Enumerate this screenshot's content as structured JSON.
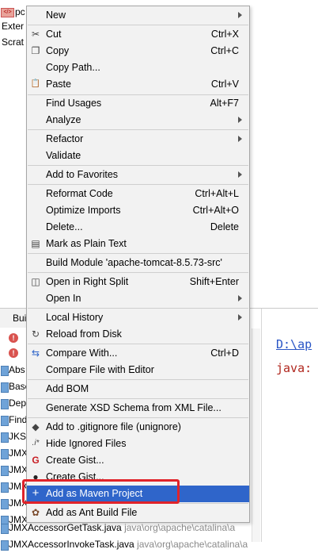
{
  "background": {
    "project": {
      "row1": "pc",
      "row2": "Exter",
      "row3": "Scrat"
    },
    "tool_tab": "Bui",
    "file_list": [
      {
        "name": "Abs",
        "path": ""
      },
      {
        "name": "Base",
        "path": ""
      },
      {
        "name": "Dep",
        "path": ""
      },
      {
        "name": "Find",
        "path": ""
      },
      {
        "name": "JKSt",
        "path": ""
      },
      {
        "name": "JMX",
        "path": ""
      },
      {
        "name": "JMX",
        "path": ""
      },
      {
        "name": "JMX",
        "path": ""
      },
      {
        "name": "JMX",
        "path": ""
      },
      {
        "name": "JMX",
        "path": ""
      },
      {
        "name": "JMXAccessorGetTask.java",
        "path": "java\\org\\apache\\catalina\\a"
      },
      {
        "name": "JMXAccessorInvokeTask.java",
        "path": "java\\org\\apache\\catalina\\a"
      }
    ],
    "error_glyph": "!",
    "code_line1": "D:\\ap",
    "code_line2": "java:"
  },
  "menu": {
    "items": [
      {
        "label": "New",
        "shortcut": "",
        "submenu": true,
        "icon": ""
      },
      {
        "label": "Cut",
        "shortcut": "Ctrl+X",
        "icon": "scissors-icon"
      },
      {
        "label": "Copy",
        "shortcut": "Ctrl+C",
        "icon": "copy-icon"
      },
      {
        "label": "Copy Path...",
        "shortcut": "",
        "icon": ""
      },
      {
        "label": "Paste",
        "shortcut": "Ctrl+V",
        "icon": "clipboard-icon"
      },
      {
        "label": "Find Usages",
        "shortcut": "Alt+F7",
        "icon": ""
      },
      {
        "label": "Analyze",
        "shortcut": "",
        "submenu": true,
        "icon": ""
      },
      {
        "label": "Refactor",
        "shortcut": "",
        "submenu": true,
        "icon": ""
      },
      {
        "label": "Validate",
        "shortcut": "",
        "icon": ""
      },
      {
        "label": "Add to Favorites",
        "shortcut": "",
        "submenu": true,
        "icon": ""
      },
      {
        "label": "Reformat Code",
        "shortcut": "Ctrl+Alt+L",
        "icon": ""
      },
      {
        "label": "Optimize Imports",
        "shortcut": "Ctrl+Alt+O",
        "icon": ""
      },
      {
        "label": "Delete...",
        "shortcut": "Delete",
        "icon": ""
      },
      {
        "label": "Mark as Plain Text",
        "shortcut": "",
        "icon": "plain-text-icon"
      },
      {
        "label": "Build Module 'apache-tomcat-8.5.73-src'",
        "shortcut": "",
        "icon": ""
      },
      {
        "label": "Open in Right Split",
        "shortcut": "Shift+Enter",
        "icon": "split-icon"
      },
      {
        "label": "Open In",
        "shortcut": "",
        "submenu": true,
        "icon": ""
      },
      {
        "label": "Local History",
        "shortcut": "",
        "submenu": true,
        "icon": ""
      },
      {
        "label": "Reload from Disk",
        "shortcut": "",
        "icon": "reload-icon"
      },
      {
        "label": "Compare With...",
        "shortcut": "Ctrl+D",
        "icon": "compare-icon"
      },
      {
        "label": "Compare File with Editor",
        "shortcut": "",
        "icon": ""
      },
      {
        "label": "Add BOM",
        "shortcut": "",
        "icon": ""
      },
      {
        "label": "Generate XSD Schema from XML File...",
        "shortcut": "",
        "icon": ""
      },
      {
        "label": "Add to .gitignore file (unignore)",
        "shortcut": "",
        "icon": "gitignore-icon"
      },
      {
        "label": "Hide Ignored Files",
        "shortcut": "",
        "icon": "ignore-icon"
      },
      {
        "label": "Create Gist...",
        "shortcut": "",
        "icon": "gitee-icon"
      },
      {
        "label": "Create Gist...",
        "shortcut": "",
        "icon": "github-icon"
      },
      {
        "label": "Add as Maven Project",
        "shortcut": "",
        "icon": "plus-icon",
        "highlighted": true
      },
      {
        "label": "Add as Ant Build File",
        "shortcut": "",
        "icon": "ant-icon"
      }
    ],
    "icons": {
      "scissors": "✂",
      "copy": "❐",
      "clipboard": "📋",
      "plain_text": "▤",
      "split": "◫",
      "reload": "↻",
      "compare": "⇆",
      "gitignore": "◆",
      "ignore": ".i*",
      "gitee": "G",
      "github": "●",
      "plus": "+",
      "ant": "✿"
    },
    "colors": {
      "highlight": "#2f65ca",
      "annotation_box": "#e0232a",
      "gitee": "#c71d23"
    }
  }
}
